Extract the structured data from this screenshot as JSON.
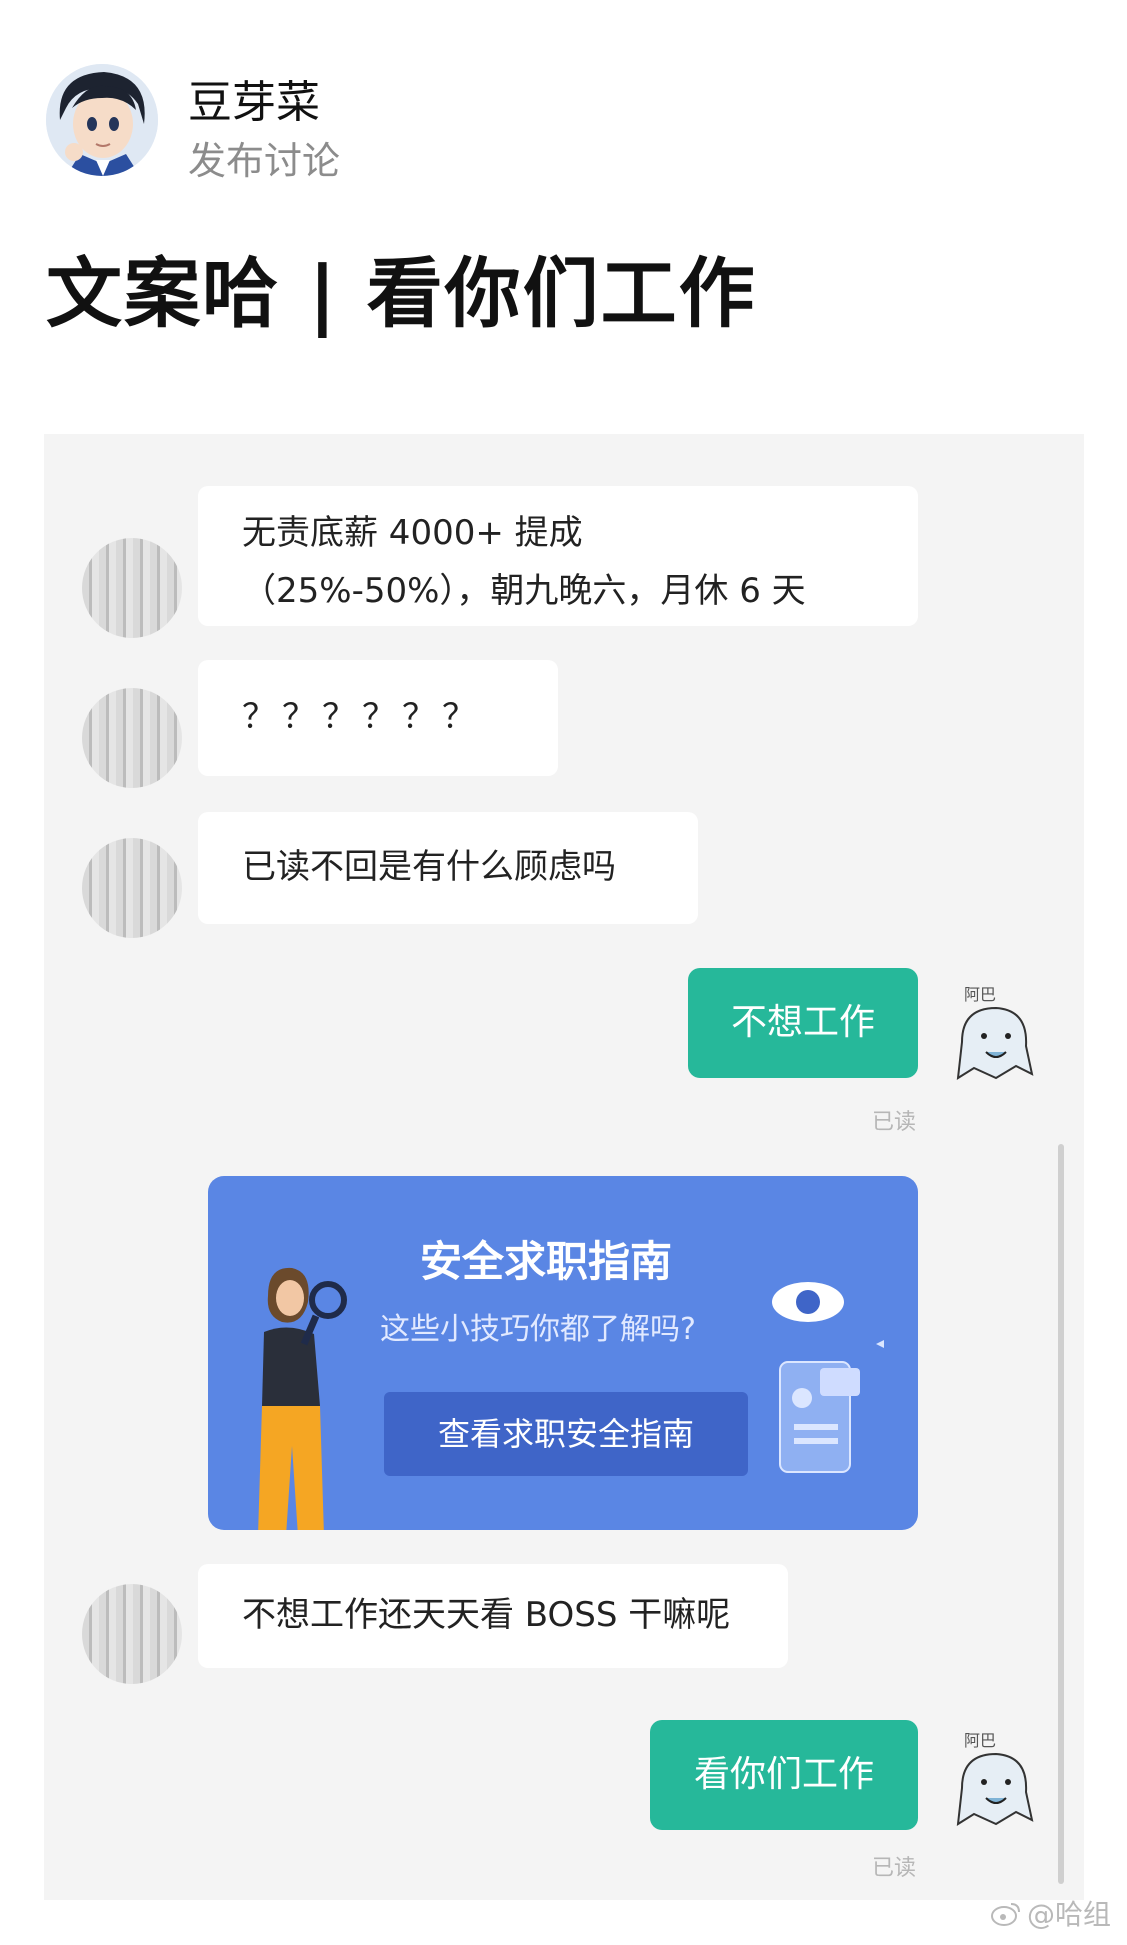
{
  "author": {
    "name": "豆芽菜",
    "post_type": "发布讨论"
  },
  "post": {
    "title": "文案哈 | 看你们工作"
  },
  "chat": {
    "messages": [
      {
        "from": "other",
        "lines": [
          "无责底薪 4000+ 提成",
          "（25%-50%），朝九晚六，月休 6 天"
        ]
      },
      {
        "from": "other",
        "text": "？？？？？？"
      },
      {
        "from": "other",
        "text": "已读不回是有什么顾虑吗"
      },
      {
        "from": "me",
        "text": "不想工作",
        "status": "已读"
      },
      {
        "from": "other",
        "text": "不想工作还天天看 BOSS 干嘛呢"
      },
      {
        "from": "me",
        "text": "看你们工作",
        "status": "已读"
      }
    ],
    "guide_card": {
      "title": "安全求职指南",
      "subtitle": "这些小技巧你都了解吗?",
      "button": "查看求职安全指南"
    },
    "sticker_caption": "阿巴阿巴"
  },
  "watermark": "@哈组",
  "colors": {
    "bubble_out": "#26b89a",
    "guide_card": "#5a86e4",
    "guide_button": "#3f65c8"
  }
}
